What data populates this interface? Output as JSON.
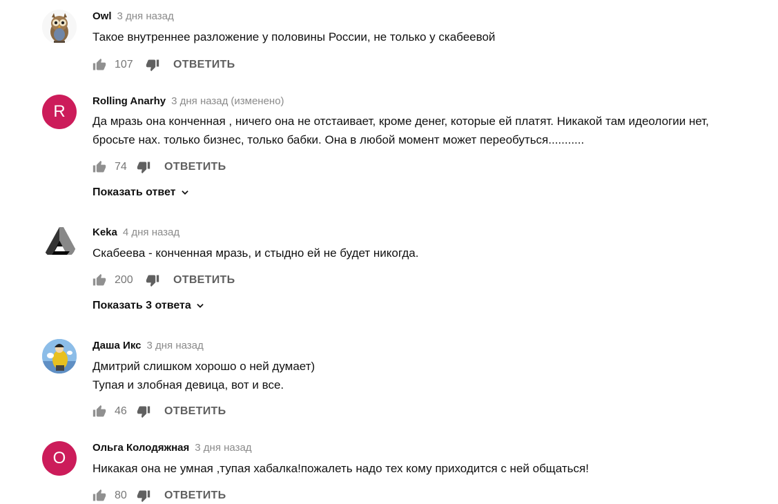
{
  "colors": {
    "avatar_red": "#cc1c5a",
    "meta_gray": "#8a8a8a",
    "action_gray": "#666666"
  },
  "comments": [
    {
      "author": "Owl",
      "time": "3 дня назад",
      "edited": "",
      "avatar": "owl-image",
      "lines": [
        "Такое внутреннее разложение у половины России, не только у скабеевой"
      ],
      "likes": "107",
      "reply_label": "ОТВЕТИТЬ"
    },
    {
      "author": "Rolling Anarhy",
      "time": "3 дня назад",
      "edited": "(изменено)",
      "avatar": "R",
      "lines": [
        "Да мразь она конченная , ничего она не отстаивает, кроме денег, которые ей платят. Никакой там идеологии нет,",
        "бросьте нах. только бизнес, только бабки. Она в любой момент может переобуться..........."
      ],
      "likes": "74",
      "reply_label": "ОТВЕТИТЬ",
      "show_replies": "Показать ответ"
    },
    {
      "author": "Keka",
      "time": "4 дня назад",
      "edited": "",
      "avatar": "penrose-triangle-logo",
      "lines": [
        "Скабеева - конченная мразь, и стыдно ей не будет никогда."
      ],
      "likes": "200",
      "reply_label": "ОТВЕТИТЬ",
      "show_replies": "Показать 3 ответа"
    },
    {
      "author": "Даша Икс",
      "time": "3 дня назад",
      "edited": "",
      "avatar": "photo-avatar",
      "lines": [
        "Дмитрий слишком хорошо о ней думает)",
        "Тупая и злобная девица, вот и все."
      ],
      "likes": "46",
      "reply_label": "ОТВЕТИТЬ"
    },
    {
      "author": "Ольга Колодяжная",
      "time": "3 дня назад",
      "edited": "",
      "avatar": "О",
      "lines": [
        "Никакая она не умная ,тупая хабалка!пожалеть надо тех кому приходится с ней общаться!"
      ],
      "likes": "80",
      "reply_label": "ОТВЕТИТЬ"
    }
  ]
}
